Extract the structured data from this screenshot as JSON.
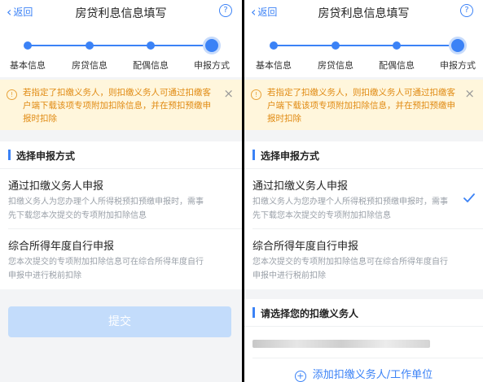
{
  "nav": {
    "back_label": "返回",
    "title": "房贷利息信息填写",
    "help_glyph": "?"
  },
  "steps": {
    "labels": [
      "基本信息",
      "房贷信息",
      "配偶信息",
      "申报方式"
    ],
    "active_index": 3
  },
  "notice": {
    "text": "若指定了扣缴义务人，则扣缴义务人可通过扣缴客户端下载该项专项附加扣除信息，并在预扣预缴申报时扣除",
    "close_glyph": "×",
    "icon_glyph": "!"
  },
  "method_section": {
    "title": "选择申报方式"
  },
  "options": [
    {
      "title": "通过扣缴义务人申报",
      "desc": "扣缴义务人为您办理个人所得税预扣预缴申报时，需事先下载您本次提交的专项附加扣除信息"
    },
    {
      "title": "综合所得年度自行申报",
      "desc": "您本次提交的专项附加扣除信息可在综合所得年度自行申报中进行税前扣除"
    }
  ],
  "submit_label": "提交",
  "withholder_section": {
    "title": "请选择您的扣缴义务人",
    "add_label": "添加扣缴义务人/工作单位",
    "plus_glyph": "+"
  },
  "right_selected_option": 0,
  "colors": {
    "accent": "#3b82f6",
    "notice_bg": "#fff6dc",
    "notice_text": "#e08a12",
    "submit_disabled": "#c3dcfb"
  }
}
